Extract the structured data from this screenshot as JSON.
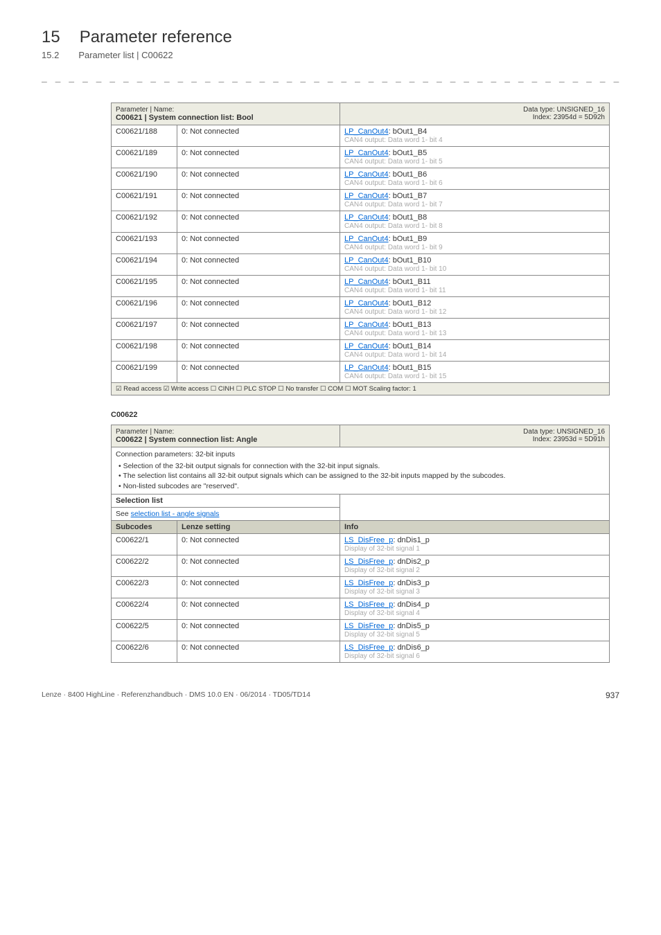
{
  "header": {
    "chapter_num": "15",
    "chapter_title": "Parameter reference",
    "sub_num": "15.2",
    "sub_title": "Parameter list | C00622"
  },
  "dashes": "_ _ _ _ _ _ _ _ _ _ _ _ _ _ _ _ _ _ _ _ _ _ _ _ _ _ _ _ _ _ _ _ _ _ _ _ _ _ _ _ _ _ _ _ _ _ _ _ _ _ _ _ _ _ _ _ _ _ _ _ _ _ _ _",
  "table1": {
    "head_label": "Parameter | Name:",
    "head_title": "C00621 | System connection list: Bool",
    "head_type": "Data type: UNSIGNED_16",
    "head_index": "Index: 23954d = 5D92h",
    "rows": [
      {
        "code": "C00621/188",
        "setting": "0: Not connected",
        "link": "LP_CanOut4",
        "after": ": bOut1_B4",
        "desc": "CAN4 output: Data word 1- bit 4"
      },
      {
        "code": "C00621/189",
        "setting": "0: Not connected",
        "link": "LP_CanOut4",
        "after": ": bOut1_B5",
        "desc": "CAN4 output: Data word 1- bit 5"
      },
      {
        "code": "C00621/190",
        "setting": "0: Not connected",
        "link": "LP_CanOut4",
        "after": ": bOut1_B6",
        "desc": "CAN4 output: Data word 1- bit 6"
      },
      {
        "code": "C00621/191",
        "setting": "0: Not connected",
        "link": "LP_CanOut4",
        "after": ": bOut1_B7",
        "desc": "CAN4 output: Data word 1- bit 7"
      },
      {
        "code": "C00621/192",
        "setting": "0: Not connected",
        "link": "LP_CanOut4",
        "after": ": bOut1_B8",
        "desc": "CAN4 output: Data word 1- bit 8"
      },
      {
        "code": "C00621/193",
        "setting": "0: Not connected",
        "link": "LP_CanOut4",
        "after": ": bOut1_B9",
        "desc": "CAN4 output: Data word 1- bit 9"
      },
      {
        "code": "C00621/194",
        "setting": "0: Not connected",
        "link": "LP_CanOut4",
        "after": ": bOut1_B10",
        "desc": "CAN4 output: Data word 1- bit 10"
      },
      {
        "code": "C00621/195",
        "setting": "0: Not connected",
        "link": "LP_CanOut4",
        "after": ": bOut1_B11",
        "desc": "CAN4 output: Data word 1- bit 11"
      },
      {
        "code": "C00621/196",
        "setting": "0: Not connected",
        "link": "LP_CanOut4",
        "after": ": bOut1_B12",
        "desc": "CAN4 output: Data word 1- bit 12"
      },
      {
        "code": "C00621/197",
        "setting": "0: Not connected",
        "link": "LP_CanOut4",
        "after": ": bOut1_B13",
        "desc": "CAN4 output: Data word 1- bit 13"
      },
      {
        "code": "C00621/198",
        "setting": "0: Not connected",
        "link": "LP_CanOut4",
        "after": ": bOut1_B14",
        "desc": "CAN4 output: Data word 1- bit 14"
      },
      {
        "code": "C00621/199",
        "setting": "0: Not connected",
        "link": "LP_CanOut4",
        "after": ": bOut1_B15",
        "desc": "CAN4 output: Data word 1- bit 15"
      }
    ],
    "footer": "☑ Read access   ☑ Write access   ☐ CINH   ☐ PLC STOP   ☐ No transfer   ☐ COM   ☐ MOT    Scaling factor: 1"
  },
  "section2_id": "C00622",
  "table2": {
    "head_label": "Parameter | Name:",
    "head_title": "C00622 | System connection list: Angle",
    "head_type": "Data type: UNSIGNED_16",
    "head_index": "Index: 23953d = 5D91h",
    "desc_title": "Connection parameters: 32-bit inputs",
    "desc_items": [
      "Selection of the 32-bit output signals for connection with the 32-bit input signals.",
      "The selection list contains all 32-bit output signals which can be assigned to the 32-bit inputs mapped by the subcodes.",
      "Non-listed subcodes are \"reserved\"."
    ],
    "selection_label": "Selection list",
    "selection_see": "See ",
    "selection_link": "selection list - angle signals",
    "subcodes_h1": "Subcodes",
    "subcodes_h2": "Lenze setting",
    "subcodes_h3": "Info",
    "rows": [
      {
        "code": "C00622/1",
        "setting": "0: Not connected",
        "link": "LS_DisFree_p",
        "after": ": dnDis1_p",
        "desc": "Display of 32-bit signal 1"
      },
      {
        "code": "C00622/2",
        "setting": "0: Not connected",
        "link": "LS_DisFree_p",
        "after": ": dnDis2_p",
        "desc": "Display of 32-bit signal 2"
      },
      {
        "code": "C00622/3",
        "setting": "0: Not connected",
        "link": "LS_DisFree_p",
        "after": ": dnDis3_p",
        "desc": "Display of 32-bit signal 3"
      },
      {
        "code": "C00622/4",
        "setting": "0: Not connected",
        "link": "LS_DisFree_p",
        "after": ": dnDis4_p",
        "desc": "Display of 32-bit signal 4"
      },
      {
        "code": "C00622/5",
        "setting": "0: Not connected",
        "link": "LS_DisFree_p",
        "after": ": dnDis5_p",
        "desc": "Display of 32-bit signal 5"
      },
      {
        "code": "C00622/6",
        "setting": "0: Not connected",
        "link": "LS_DisFree_p",
        "after": ": dnDis6_p",
        "desc": "Display of 32-bit signal 6"
      }
    ]
  },
  "footer": {
    "left": "Lenze · 8400 HighLine · Referenzhandbuch · DMS 10.0 EN · 06/2014 · TD05/TD14",
    "right": "937"
  }
}
